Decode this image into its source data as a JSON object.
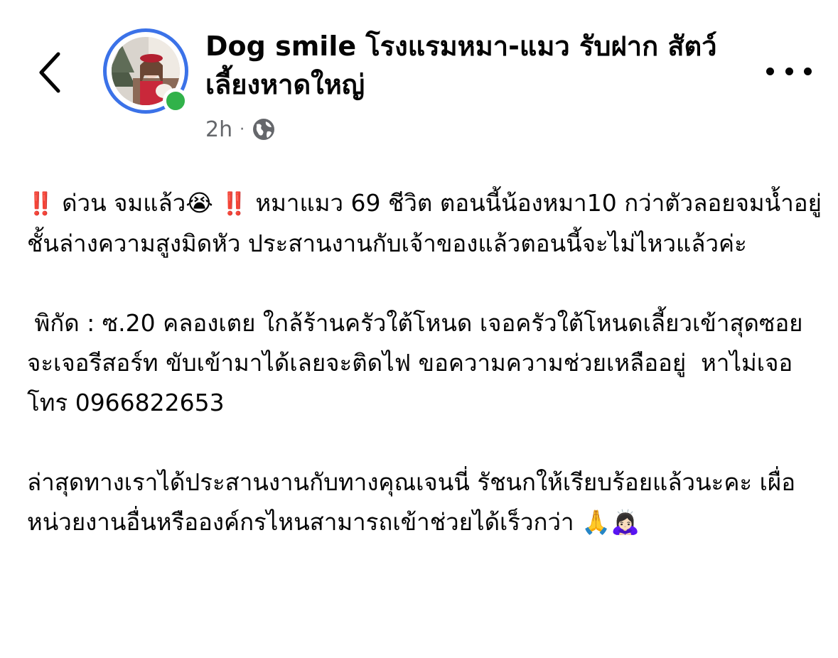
{
  "header": {
    "page_name": "Dog smile โรงแรมหมา-แมว รับฝาก สัตว์เลี้ยงหาดใหญ่",
    "time_ago": "2h",
    "separator": "·",
    "privacy_icon": "globe-icon",
    "back_icon": "chevron-left-icon",
    "more_icon": "more-horizontal-icon",
    "avatar_ring_color": "#3b72e8",
    "online_color": "#31b24a"
  },
  "post": {
    "line1_prefix_emoji": "‼️",
    "line1_text_a": "ด่วน จมแล้ว",
    "line1_crying_emoji": "😭",
    "line1_mid_emoji": "‼️",
    "line1_text_b": "หมาแมว 69 ชีวิต ตอนนี้น้องหมา10 กว่าตัวลอยจมน้ำอยู่ชั้นล่างความสูงมิดหัว ประสานงานกับเจ้าของแล้วตอนนี้จะไม่ไหวแล้วค่ะ",
    "location_text": " พิกัด : ซ.20 คลองเตย ใกล้ร้านครัวใต้โหนด เจอครัวใต้โหนดเลี้ยวเข้าสุดซอยจะเจอรีสอร์ท ขับเข้ามาได้เลยจะติดไฟ ขอความความช่วยเหลืออยู่  หาไม่เจอโทร 0966822653",
    "update_text": "ล่าสุดทางเราได้ประสานงานกับทางคุณเจนนี่ รัชนกให้เรียบร้อยแล้วนะคะ เผื่อหน่วยงานอื่นหรือองค์กรไหนสามารถเข้าช่วยได้เร็วกว่า",
    "update_emojis": "🙏🙇🏻‍♀️"
  }
}
